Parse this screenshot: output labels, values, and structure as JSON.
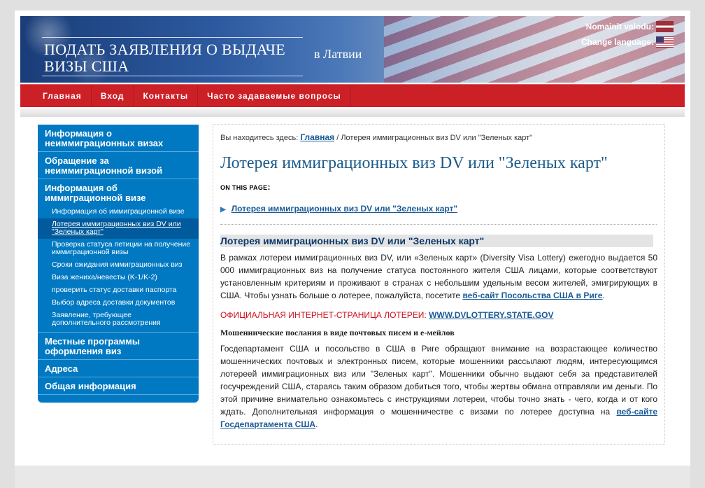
{
  "header": {
    "title": "ПОДАТЬ ЗАЯВЛЕНИЯ О ВЫДАЧЕ ВИЗЫ США",
    "subtitle": "в Латвии",
    "lang_lv_label": "Nomainīt valodu",
    "lang_en_label": "Change language",
    "colon": ":"
  },
  "nav": {
    "items": [
      "Главная",
      "Вход",
      "Контакты",
      "Часто задаваемые вопросы"
    ]
  },
  "sidebar": {
    "items": [
      "Информация о неиммиграционных визах",
      "Обращение за неиммиграционной визой",
      "Информация об иммиграционной визе",
      "Местные программы оформления виз",
      "Адреса",
      "Общая информация"
    ],
    "subitems": [
      "Информация об иммиграционной визе",
      "Лотерея иммиграционных виз DV или \"Зеленых карт\"",
      "Проверка статуса петиции на получение иммиграционной визы",
      "Сроки ожидания иммиграционных виз",
      "Виза жениха/невесты (K-1/K-2)",
      "проверить статус доставки паспорта",
      "Выбор адреса доставки документов",
      "Заявление, требующее дополнительного рассмотрения"
    ]
  },
  "content": {
    "crumb_prefix": "Вы находитесь здесь:",
    "crumb_home": "Главная",
    "crumb_current": "/ Лотерея иммиграционных виз DV или \"Зеленых карт\"",
    "heading": "Лотерея иммиграционных виз DV или \"Зеленых карт\"",
    "on_this_page": "on this page",
    "toc_item": "Лотерея иммиграционных виз DV или \"Зеленых карт\"",
    "section_title": "Лотерея иммиграционных виз DV или \"Зеленых карт\"",
    "para1": "В рамках лотереи иммиграционных виз DV, или «Зеленых карт» (Diversity Visa Lottery) ежегодно выдается 50 000 иммиграционных виз на получение статуса постоянного жителя США лицами, которые соответствуют установленным критериям и проживают в странах с небольшим удельным весом жителей, эмигрирующих в США. Чтобы узнать больше о лотерее, пожалуйста, посетите",
    "para1_link": "веб-сайт Посольства США в Риге",
    "official_label": "ОФИЦИАЛЬНАЯ ИНТЕРНЕТ-СТРАНИЦА ЛОТЕРЕИ:",
    "official_link": "WWW.DVLOTTERY.STATE.GOV",
    "fraud_heading": "Мошеннические послания в виде почтовых писем и е-мейлов",
    "para2": "Госдепартамент США и посольство в США в Риге обращают внимание на возрастающее количество мошеннических почтовых и электронных писем, которые мошенники рассылают людям, интересующимся лотереей иммиграционных виз или \"Зеленых карт\". Мошенники обычно выдают себя за представителей госучреждений США, стараясь таким образом добиться того, чтобы жертвы обмана отправляли им деньги. По этой причине внимательно ознакомьтесь с инструкциями лотереи, чтобы точно знать - чего, когда и от кого ждать. Дополнительная информация о мошенничестве с визами по лотерее доступна на",
    "para2_link": "веб-сайте Госдепартамента США",
    "period": "."
  },
  "colors": {
    "nav_red": "#cc2027",
    "sidebar_blue": "#0079c2",
    "link_blue": "#1a5a96",
    "heading_blue": "#1a5a8a",
    "alert_red": "#cc1020"
  },
  "icons": [
    "latvia-flag-icon",
    "us-flag-icon",
    "arrow-right-icon"
  ]
}
